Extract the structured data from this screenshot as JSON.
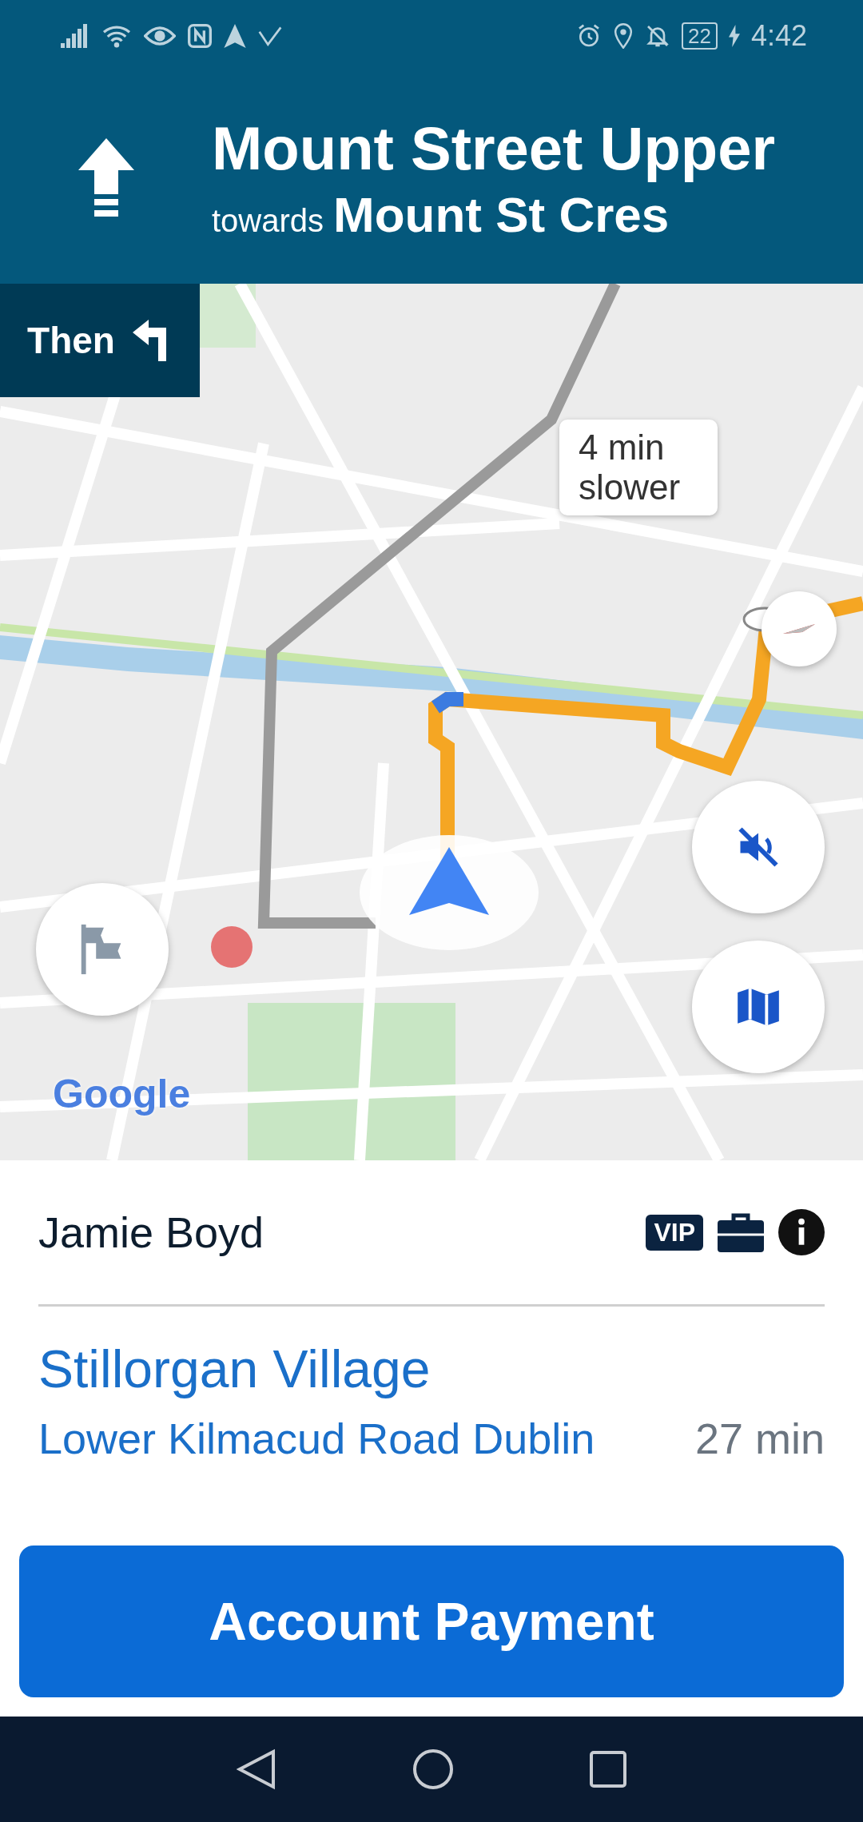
{
  "status_bar": {
    "battery": "22",
    "time": "4:42"
  },
  "maneuver": {
    "street": "Mount Street Upper",
    "towards_label": "towards",
    "towards_street": "Mount St Cres"
  },
  "next_turn": {
    "label": "Then"
  },
  "map": {
    "traffic_callout": "4 min slower",
    "logo": "Google",
    "sound_muted": true
  },
  "passenger": {
    "name": "Jamie Boyd",
    "vip_badge": "VIP"
  },
  "destination": {
    "name": "Stillorgan Village",
    "address": "Lower Kilmacud Road Dublin",
    "eta": "27 min"
  },
  "payment_button": "Account Payment"
}
